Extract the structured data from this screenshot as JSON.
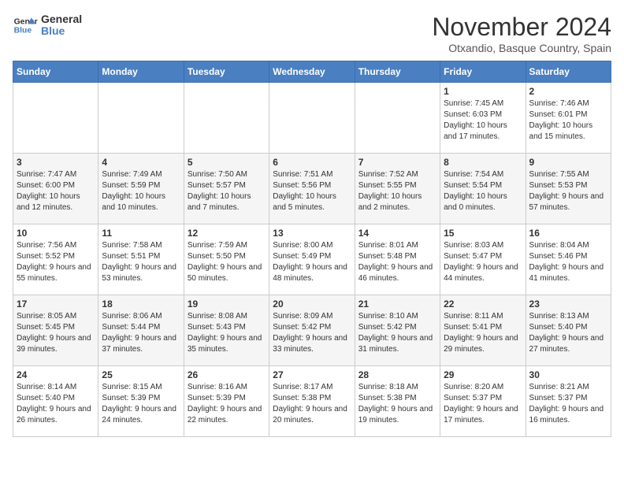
{
  "logo": {
    "general": "General",
    "blue": "Blue"
  },
  "title": "November 2024",
  "location": "Otxandio, Basque Country, Spain",
  "days_header": [
    "Sunday",
    "Monday",
    "Tuesday",
    "Wednesday",
    "Thursday",
    "Friday",
    "Saturday"
  ],
  "weeks": [
    [
      {
        "day": "",
        "info": ""
      },
      {
        "day": "",
        "info": ""
      },
      {
        "day": "",
        "info": ""
      },
      {
        "day": "",
        "info": ""
      },
      {
        "day": "",
        "info": ""
      },
      {
        "day": "1",
        "info": "Sunrise: 7:45 AM\nSunset: 6:03 PM\nDaylight: 10 hours and 17 minutes."
      },
      {
        "day": "2",
        "info": "Sunrise: 7:46 AM\nSunset: 6:01 PM\nDaylight: 10 hours and 15 minutes."
      }
    ],
    [
      {
        "day": "3",
        "info": "Sunrise: 7:47 AM\nSunset: 6:00 PM\nDaylight: 10 hours and 12 minutes."
      },
      {
        "day": "4",
        "info": "Sunrise: 7:49 AM\nSunset: 5:59 PM\nDaylight: 10 hours and 10 minutes."
      },
      {
        "day": "5",
        "info": "Sunrise: 7:50 AM\nSunset: 5:57 PM\nDaylight: 10 hours and 7 minutes."
      },
      {
        "day": "6",
        "info": "Sunrise: 7:51 AM\nSunset: 5:56 PM\nDaylight: 10 hours and 5 minutes."
      },
      {
        "day": "7",
        "info": "Sunrise: 7:52 AM\nSunset: 5:55 PM\nDaylight: 10 hours and 2 minutes."
      },
      {
        "day": "8",
        "info": "Sunrise: 7:54 AM\nSunset: 5:54 PM\nDaylight: 10 hours and 0 minutes."
      },
      {
        "day": "9",
        "info": "Sunrise: 7:55 AM\nSunset: 5:53 PM\nDaylight: 9 hours and 57 minutes."
      }
    ],
    [
      {
        "day": "10",
        "info": "Sunrise: 7:56 AM\nSunset: 5:52 PM\nDaylight: 9 hours and 55 minutes."
      },
      {
        "day": "11",
        "info": "Sunrise: 7:58 AM\nSunset: 5:51 PM\nDaylight: 9 hours and 53 minutes."
      },
      {
        "day": "12",
        "info": "Sunrise: 7:59 AM\nSunset: 5:50 PM\nDaylight: 9 hours and 50 minutes."
      },
      {
        "day": "13",
        "info": "Sunrise: 8:00 AM\nSunset: 5:49 PM\nDaylight: 9 hours and 48 minutes."
      },
      {
        "day": "14",
        "info": "Sunrise: 8:01 AM\nSunset: 5:48 PM\nDaylight: 9 hours and 46 minutes."
      },
      {
        "day": "15",
        "info": "Sunrise: 8:03 AM\nSunset: 5:47 PM\nDaylight: 9 hours and 44 minutes."
      },
      {
        "day": "16",
        "info": "Sunrise: 8:04 AM\nSunset: 5:46 PM\nDaylight: 9 hours and 41 minutes."
      }
    ],
    [
      {
        "day": "17",
        "info": "Sunrise: 8:05 AM\nSunset: 5:45 PM\nDaylight: 9 hours and 39 minutes."
      },
      {
        "day": "18",
        "info": "Sunrise: 8:06 AM\nSunset: 5:44 PM\nDaylight: 9 hours and 37 minutes."
      },
      {
        "day": "19",
        "info": "Sunrise: 8:08 AM\nSunset: 5:43 PM\nDaylight: 9 hours and 35 minutes."
      },
      {
        "day": "20",
        "info": "Sunrise: 8:09 AM\nSunset: 5:42 PM\nDaylight: 9 hours and 33 minutes."
      },
      {
        "day": "21",
        "info": "Sunrise: 8:10 AM\nSunset: 5:42 PM\nDaylight: 9 hours and 31 minutes."
      },
      {
        "day": "22",
        "info": "Sunrise: 8:11 AM\nSunset: 5:41 PM\nDaylight: 9 hours and 29 minutes."
      },
      {
        "day": "23",
        "info": "Sunrise: 8:13 AM\nSunset: 5:40 PM\nDaylight: 9 hours and 27 minutes."
      }
    ],
    [
      {
        "day": "24",
        "info": "Sunrise: 8:14 AM\nSunset: 5:40 PM\nDaylight: 9 hours and 26 minutes."
      },
      {
        "day": "25",
        "info": "Sunrise: 8:15 AM\nSunset: 5:39 PM\nDaylight: 9 hours and 24 minutes."
      },
      {
        "day": "26",
        "info": "Sunrise: 8:16 AM\nSunset: 5:39 PM\nDaylight: 9 hours and 22 minutes."
      },
      {
        "day": "27",
        "info": "Sunrise: 8:17 AM\nSunset: 5:38 PM\nDaylight: 9 hours and 20 minutes."
      },
      {
        "day": "28",
        "info": "Sunrise: 8:18 AM\nSunset: 5:38 PM\nDaylight: 9 hours and 19 minutes."
      },
      {
        "day": "29",
        "info": "Sunrise: 8:20 AM\nSunset: 5:37 PM\nDaylight: 9 hours and 17 minutes."
      },
      {
        "day": "30",
        "info": "Sunrise: 8:21 AM\nSunset: 5:37 PM\nDaylight: 9 hours and 16 minutes."
      }
    ]
  ]
}
